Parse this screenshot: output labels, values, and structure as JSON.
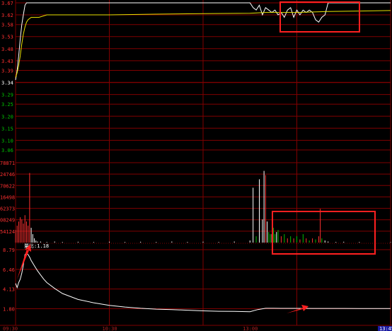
{
  "colors": {
    "background": "#000000",
    "grid": "#800000",
    "price_axis_up": "#ff3030",
    "price_axis_down": "#00c000",
    "base_price_label": "#ffffff",
    "volume_axis": "#ff3030",
    "ratio_axis": "#ff3030",
    "time_axis": "#b02020",
    "price_line": "#ffffff",
    "avg_line": "#e8e000",
    "vol_up": "#ff3030",
    "vol_down": "#00c000",
    "vol_flat": "#ffffff",
    "ratio_line": "#ffffff",
    "highlight_box": "#ff2020",
    "arrow": "#ff2020",
    "time_end_bg": "#1a1aa0"
  },
  "chart_data": [
    {
      "type": "line",
      "panel": "price",
      "yticks": [
        "3.67",
        "3.62",
        "3.58",
        "3.53",
        "3.48",
        "3.43",
        "3.39",
        "3.34",
        "3.29",
        "3.25",
        "3.20",
        "3.15",
        "3.10",
        "3.06"
      ],
      "ytick_values": [
        3.67,
        3.62,
        3.58,
        3.53,
        3.48,
        3.43,
        3.39,
        3.34,
        3.29,
        3.25,
        3.2,
        3.15,
        3.1,
        3.06
      ],
      "base_price": 3.34,
      "ylim": [
        3.06,
        3.67
      ],
      "xlim": [
        0,
        240
      ],
      "series": [
        {
          "role": "price",
          "x": [
            0,
            1,
            2,
            3,
            4,
            5,
            6,
            7,
            8,
            9,
            10,
            12,
            15,
            20,
            30,
            40,
            60,
            90,
            120,
            140,
            150,
            152,
            154,
            156,
            158,
            160,
            162,
            164,
            166,
            168,
            170,
            172,
            174,
            176,
            178,
            180,
            182,
            184,
            186,
            188,
            190,
            192,
            194,
            196,
            198,
            200,
            220,
            240
          ],
          "y": [
            3.35,
            3.39,
            3.45,
            3.52,
            3.58,
            3.62,
            3.66,
            3.67,
            3.67,
            3.67,
            3.67,
            3.67,
            3.67,
            3.67,
            3.67,
            3.67,
            3.67,
            3.67,
            3.67,
            3.67,
            3.67,
            3.65,
            3.64,
            3.66,
            3.62,
            3.65,
            3.64,
            3.63,
            3.64,
            3.62,
            3.63,
            3.61,
            3.64,
            3.65,
            3.61,
            3.64,
            3.62,
            3.64,
            3.63,
            3.64,
            3.63,
            3.6,
            3.59,
            3.61,
            3.62,
            3.67,
            3.67,
            3.67
          ]
        },
        {
          "role": "average",
          "x": [
            0,
            1,
            2,
            3,
            4,
            5,
            6,
            7,
            8,
            10,
            12,
            15,
            20,
            30,
            60,
            90,
            120,
            150,
            160,
            180,
            200,
            220,
            240
          ],
          "y": [
            3.36,
            3.38,
            3.41,
            3.45,
            3.5,
            3.54,
            3.57,
            3.59,
            3.6,
            3.61,
            3.61,
            3.61,
            3.62,
            3.62,
            3.62,
            3.623,
            3.625,
            3.627,
            3.63,
            3.63,
            3.634,
            3.636,
            3.638
          ]
        }
      ]
    },
    {
      "type": "bar",
      "panel": "volume",
      "yticks": [
        "78871",
        "24746",
        "70622",
        "16498",
        "62373",
        "08249",
        "54124"
      ],
      "ytick_values": [
        878871,
        824746,
        770622,
        716498,
        662373,
        608249,
        554124
      ],
      "ylim": [
        500000,
        878871
      ],
      "xlim": [
        0,
        240
      ],
      "x": [
        0,
        1,
        2,
        3,
        4,
        5,
        6,
        7,
        8,
        9,
        10,
        11,
        12,
        13,
        14,
        16,
        20,
        25,
        30,
        40,
        50,
        60,
        70,
        80,
        90,
        100,
        110,
        120,
        130,
        140,
        150,
        152,
        154,
        156,
        158,
        159,
        160,
        161,
        162,
        163,
        164,
        165,
        166,
        167,
        168,
        170,
        172,
        174,
        176,
        178,
        180,
        182,
        184,
        186,
        188,
        190,
        192,
        194,
        195,
        196,
        198,
        200,
        205,
        210,
        220,
        230,
        240
      ],
      "values": [
        560000,
        580000,
        600000,
        620000,
        610000,
        590000,
        630000,
        600000,
        580000,
        830000,
        570000,
        540000,
        520000,
        510000,
        505000,
        505000,
        503000,
        505000,
        503000,
        504000,
        503000,
        504000,
        503000,
        504000,
        503000,
        505000,
        503000,
        504000,
        503000,
        505000,
        510000,
        760000,
        530000,
        800000,
        610000,
        840000,
        820000,
        600000,
        550000,
        540000,
        540000,
        570000,
        540000,
        550000,
        560000,
        530000,
        540000,
        520000,
        530000,
        520000,
        530000,
        515000,
        540000,
        520000,
        510000,
        520000,
        515000,
        530000,
        660000,
        520000,
        510000,
        505000,
        503000,
        504000,
        503000,
        503000,
        502000
      ],
      "colors": [
        "up",
        "up",
        "up",
        "up",
        "up",
        "up",
        "up",
        "up",
        "up",
        "up",
        "flat",
        "flat",
        "flat",
        "flat",
        "flat",
        "flat",
        "flat",
        "flat",
        "flat",
        "flat",
        "flat",
        "flat",
        "flat",
        "flat",
        "flat",
        "flat",
        "flat",
        "flat",
        "flat",
        "flat",
        "flat",
        "flat",
        "down",
        "flat",
        "flat",
        "flat",
        "up",
        "flat",
        "down",
        "down",
        "flat",
        "down",
        "down",
        "flat",
        "down",
        "up",
        "down",
        "up",
        "down",
        "up",
        "down",
        "up",
        "down",
        "up",
        "down",
        "up",
        "down",
        "up",
        "up",
        "down",
        "flat",
        "flat",
        "flat",
        "flat",
        "flat",
        "flat",
        "flat"
      ]
    },
    {
      "type": "line",
      "panel": "ratio",
      "label": "量比:1.18",
      "yticks": [
        "8.79",
        "6.46",
        "4.13",
        "1.80"
      ],
      "ytick_values": [
        8.79,
        6.46,
        4.13,
        1.8
      ],
      "ylim": [
        0,
        8.79
      ],
      "xlim": [
        0,
        240
      ],
      "x": [
        0,
        1,
        2,
        3,
        4,
        5,
        6,
        7,
        8,
        9,
        10,
        11,
        12,
        14,
        16,
        18,
        20,
        25,
        30,
        40,
        50,
        60,
        70,
        80,
        90,
        100,
        110,
        120,
        130,
        140,
        150,
        155,
        160,
        165,
        170,
        180,
        190,
        200,
        210,
        220,
        230,
        240
      ],
      "y": [
        4.8,
        4.3,
        4.9,
        5.3,
        6.0,
        7.0,
        8.2,
        8.4,
        8.2,
        7.9,
        7.5,
        7.2,
        6.9,
        6.3,
        5.8,
        5.3,
        4.9,
        4.2,
        3.6,
        2.9,
        2.5,
        2.2,
        2.0,
        1.85,
        1.75,
        1.7,
        1.62,
        1.55,
        1.5,
        1.48,
        1.45,
        1.7,
        1.85,
        1.85,
        1.84,
        1.84,
        1.83,
        1.83,
        1.83,
        1.82,
        1.82,
        1.82
      ]
    }
  ],
  "time_axis": {
    "labels": [
      "09:30",
      "10:30",
      "13:00",
      "13:45"
    ],
    "values": [
      0,
      60,
      150,
      240
    ]
  },
  "annotations": {
    "boxes": [
      "price-window",
      "volume-window"
    ],
    "arrows": [
      "open-arrow",
      "afternoon-arrow"
    ]
  }
}
